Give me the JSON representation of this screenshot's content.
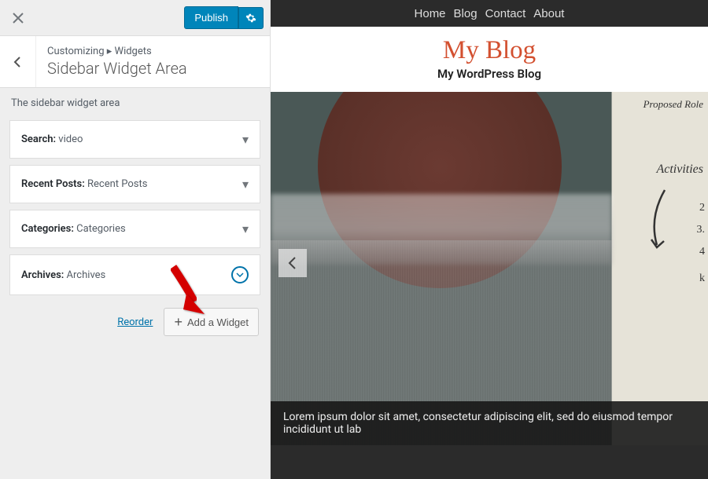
{
  "panel": {
    "publish_label": "Publish",
    "breadcrumb_pre": "Customizing",
    "breadcrumb_sep": "▸",
    "breadcrumb_cur": "Widgets",
    "title": "Sidebar Widget Area",
    "desc": "The sidebar widget area",
    "widgets": [
      {
        "type": "Search:",
        "val": "video"
      },
      {
        "type": "Recent Posts:",
        "val": "Recent Posts"
      },
      {
        "type": "Categories:",
        "val": "Categories"
      },
      {
        "type": "Archives:",
        "val": "Archives"
      }
    ],
    "reorder_label": "Reorder",
    "add_widget_label": "Add a Widget"
  },
  "preview": {
    "nav": [
      "Home",
      "Blog",
      "Contact",
      "About"
    ],
    "site_title": "My Blog",
    "site_tagline": "My WordPress Blog",
    "caption": "Lorem ipsum dolor sit amet, consectetur adipiscing elit, sed do eiusmod tempor incididunt ut lab",
    "whiteboard": {
      "t1": "Proposed Role",
      "t2": "Activities",
      "n1": "2",
      "n2": "3.",
      "n3": "4",
      "n4": "k"
    }
  }
}
